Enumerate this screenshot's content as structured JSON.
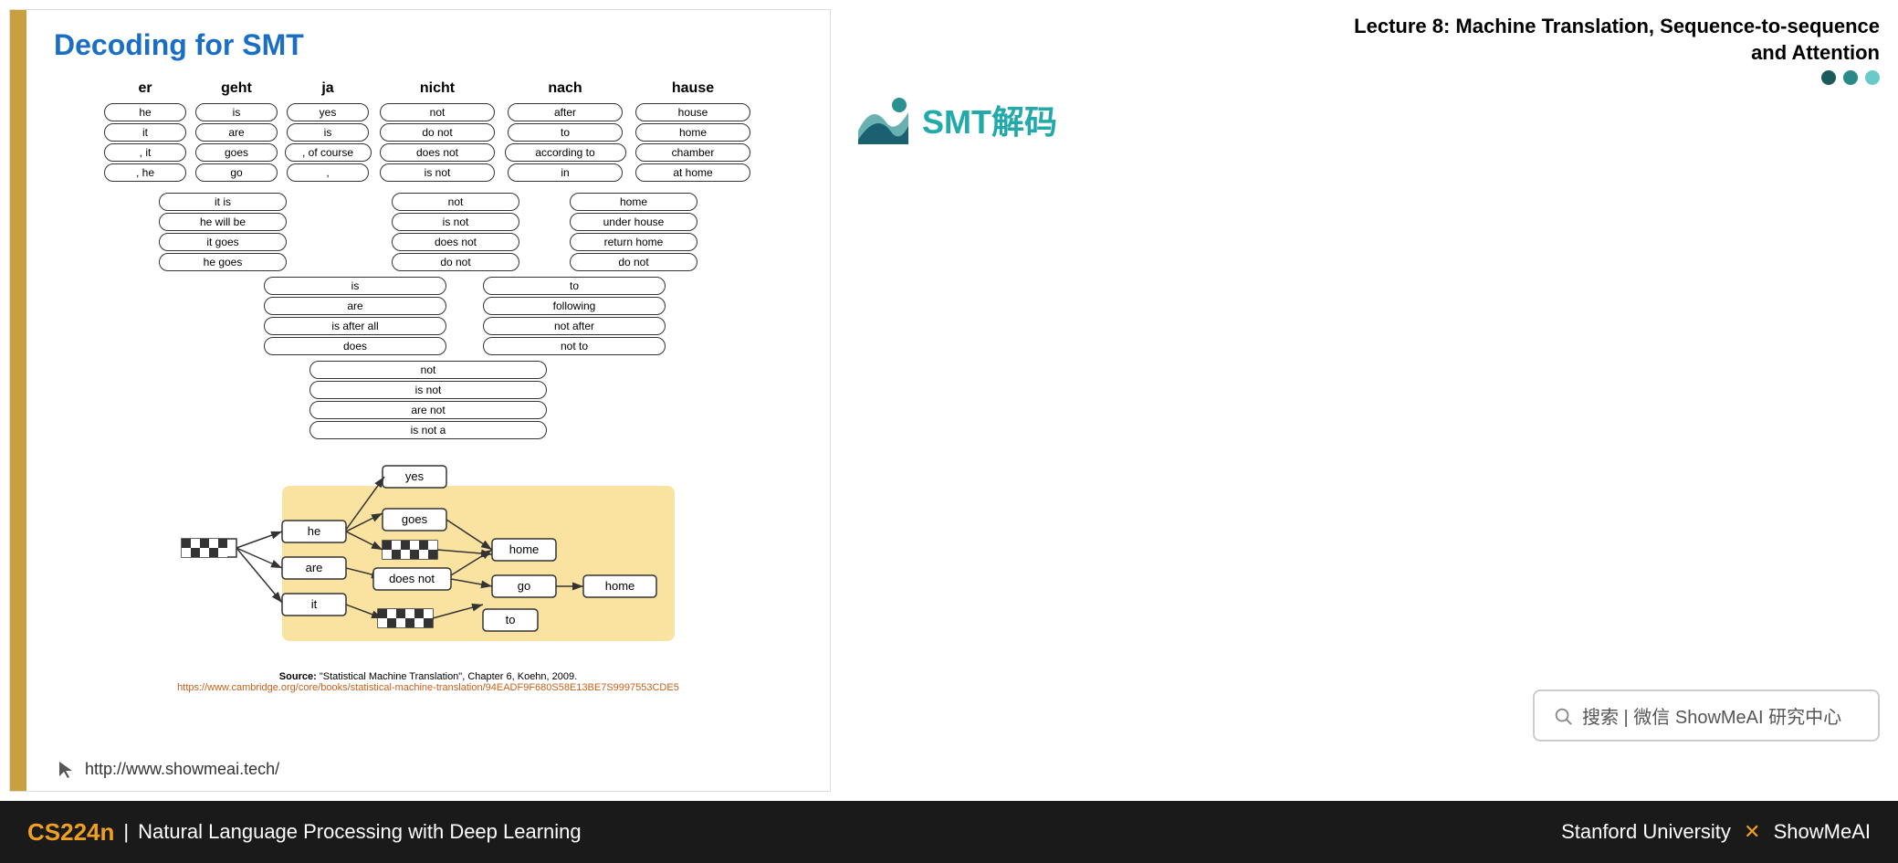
{
  "header": {
    "lecture_title": "Lecture 8:  Machine Translation, Sequence-to-sequence\nand Attention"
  },
  "slide": {
    "title": "Decoding for SMT",
    "left_bar_color": "#c8a040",
    "columns": [
      {
        "header": "er",
        "phrases": [
          "he",
          "it",
          ", it",
          ", he"
        ]
      },
      {
        "header": "geht",
        "phrases": [
          "is",
          "are",
          "goes",
          "go"
        ]
      },
      {
        "header": "ja",
        "phrases": [
          "yes",
          "is",
          ", of course",
          ","
        ]
      },
      {
        "header": "nicht",
        "phrases": [
          "not",
          "do not",
          "does not",
          "is not"
        ]
      },
      {
        "header": "nach",
        "phrases": [
          "after",
          "to",
          "according to",
          "in"
        ]
      },
      {
        "header": "hause",
        "phrases": [
          "house",
          "home",
          "chamber",
          "at home"
        ]
      }
    ],
    "span_phrases": [
      {
        "text": "it is",
        "span": "er geht"
      },
      {
        "text": "he will be",
        "span": "er geht"
      },
      {
        "text": "it goes",
        "span": "er geht"
      },
      {
        "text": "he goes",
        "span": "er geht"
      },
      {
        "text": "not",
        "span": "ja nicht"
      },
      {
        "text": "is not",
        "span": "ja nicht"
      },
      {
        "text": "does not",
        "span": "ja nicht"
      },
      {
        "text": "do not",
        "span": "ja nicht"
      },
      {
        "text": "home",
        "span": "nach hause"
      },
      {
        "text": "under house",
        "span": "nach hause"
      },
      {
        "text": "return home",
        "span": "nach hause"
      },
      {
        "text": "do not",
        "span": "nach hause"
      },
      {
        "text": "is",
        "span": "geht ja"
      },
      {
        "text": "are",
        "span": "geht ja"
      },
      {
        "text": "is after all",
        "span": "geht ja"
      },
      {
        "text": "does",
        "span": "geht ja"
      },
      {
        "text": "to",
        "span": "ja nach"
      },
      {
        "text": "following",
        "span": "ja nach"
      },
      {
        "text": "not after",
        "span": "ja nach"
      },
      {
        "text": "not to",
        "span": "ja nach"
      },
      {
        "text": "not",
        "span": "geht ja nicht"
      },
      {
        "text": "is not",
        "span": "geht ja nicht"
      },
      {
        "text": "are not",
        "span": "geht ja nicht"
      },
      {
        "text": "is not a",
        "span": "geht ja nicht"
      }
    ],
    "source_bold": "Source:",
    "source_text": " \"Statistical Machine Translation\", Chapter 6, Koehn, 2009.",
    "source_link": "https://www.cambridge.org/core/books/statistical-machine-translation/94EADF9F680S58E13BE7S9997553CDE5",
    "url": "http://www.showmeai.tech/",
    "logo_text": "SMT解码"
  },
  "right_panel": {
    "search_placeholder": "搜索 | 微信 ShowMeAI 研究中心"
  },
  "bottom_bar": {
    "course_code": "CS224n",
    "separator": "|",
    "course_name": "Natural Language Processing with Deep Learning",
    "university": "Stanford University",
    "x_symbol": "✕",
    "brand": "ShowMeAI"
  }
}
